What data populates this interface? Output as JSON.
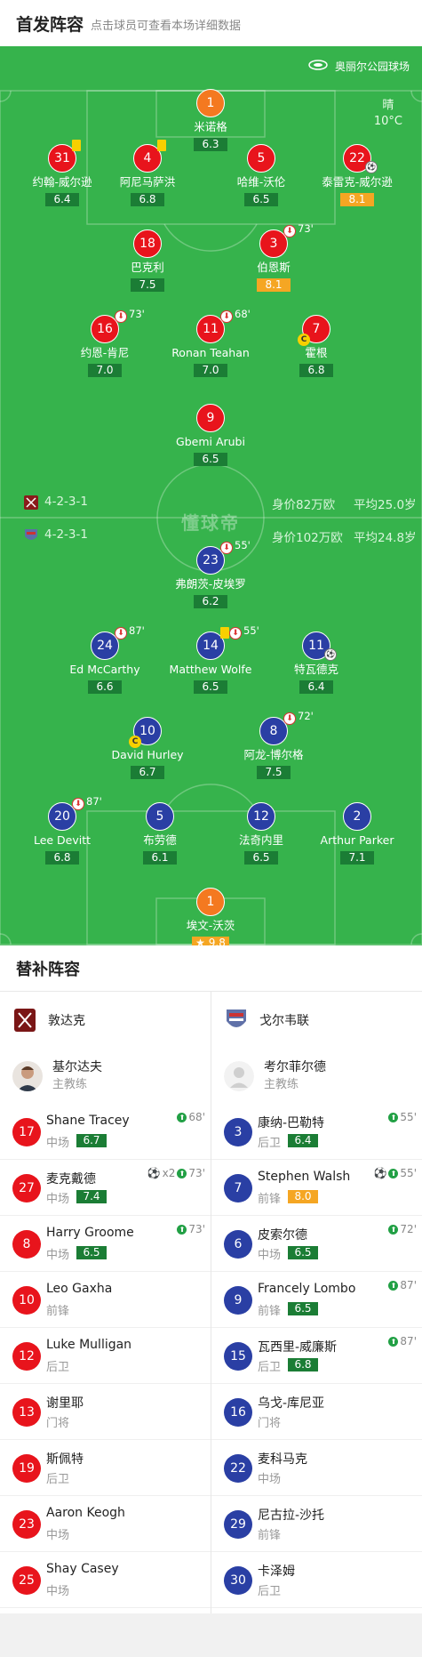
{
  "header": {
    "title": "首发阵容",
    "subtitle": "点击球员可查看本场详细数据"
  },
  "venue": "奥丽尔公园球场",
  "weather": {
    "condition": "晴",
    "temp": "10°C"
  },
  "watermark": "懂球帝",
  "home_team": {
    "formation": "4-2-3-1",
    "value": "身价82万欧",
    "avg_age": "平均25.0岁",
    "color": "#e8141c"
  },
  "away_team": {
    "formation": "4-2-3-1",
    "value": "身价102万欧",
    "avg_age": "平均24.8岁",
    "color": "#2a3fa4"
  },
  "home_players": [
    {
      "num": "1",
      "name": "米诺格",
      "rating": "6.3",
      "gk": true
    },
    {
      "num": "31",
      "name": "约翰-威尔逊",
      "rating": "6.4",
      "yellow": true
    },
    {
      "num": "4",
      "name": "阿尼马萨洪",
      "rating": "6.8",
      "yellow": true
    },
    {
      "num": "5",
      "name": "哈维-沃伦",
      "rating": "6.5"
    },
    {
      "num": "22",
      "name": "泰雷克-威尔逊",
      "rating": "8.1",
      "gold": true,
      "ball": true
    },
    {
      "num": "18",
      "name": "巴克利",
      "rating": "7.5"
    },
    {
      "num": "3",
      "name": "伯恩斯",
      "rating": "8.1",
      "gold": true,
      "sub": "73'"
    },
    {
      "num": "16",
      "name": "约恩-肯尼",
      "rating": "7.0",
      "sub": "73'"
    },
    {
      "num": "11",
      "name": "Ronan Teahan",
      "rating": "7.0",
      "sub": "68'"
    },
    {
      "num": "7",
      "name": "霍根",
      "rating": "6.8",
      "captain": true
    },
    {
      "num": "9",
      "name": "Gbemi Arubi",
      "rating": "6.5"
    }
  ],
  "away_players": [
    {
      "num": "23",
      "name": "弗朗茨-皮埃罗",
      "rating": "6.2",
      "sub": "55'"
    },
    {
      "num": "24",
      "name": "Ed McCarthy",
      "rating": "6.6",
      "sub": "87'"
    },
    {
      "num": "14",
      "name": "Matthew Wolfe",
      "rating": "6.5",
      "yellow": true,
      "sub": "55'"
    },
    {
      "num": "11",
      "name": "特瓦德克",
      "rating": "6.4",
      "ball": true
    },
    {
      "num": "10",
      "name": "David Hurley",
      "rating": "6.7",
      "captain": true
    },
    {
      "num": "8",
      "name": "阿龙-博尔格",
      "rating": "7.5",
      "sub": "72'"
    },
    {
      "num": "20",
      "name": "Lee Devitt",
      "rating": "6.8",
      "sub": "87'"
    },
    {
      "num": "5",
      "name": "布劳德",
      "rating": "6.1"
    },
    {
      "num": "12",
      "name": "法奇内里",
      "rating": "6.5"
    },
    {
      "num": "2",
      "name": "Arthur Parker",
      "rating": "7.1"
    },
    {
      "num": "1",
      "name": "埃文-沃茨",
      "rating": "9.8",
      "gold": true,
      "star": true,
      "gk": true
    }
  ],
  "subs_title": "替补阵容",
  "home_subs": {
    "team": "敦达克",
    "coach": {
      "name": "基尔达夫",
      "role": "主教练"
    },
    "players": [
      {
        "num": "17",
        "name": "Shane Tracey",
        "pos": "中场",
        "rating": "6.7",
        "event": "68'"
      },
      {
        "num": "27",
        "name": "麦克戴德",
        "pos": "中场",
        "rating": "7.4",
        "goals": "x2",
        "event": "73'"
      },
      {
        "num": "8",
        "name": "Harry Groome",
        "pos": "中场",
        "rating": "6.5",
        "event": "73'"
      },
      {
        "num": "10",
        "name": "Leo Gaxha",
        "pos": "前锋"
      },
      {
        "num": "12",
        "name": "Luke Mulligan",
        "pos": "后卫"
      },
      {
        "num": "13",
        "name": "谢里耶",
        "pos": "门将"
      },
      {
        "num": "19",
        "name": "斯佩特",
        "pos": "后卫"
      },
      {
        "num": "23",
        "name": "Aaron Keogh",
        "pos": "中场"
      },
      {
        "num": "25",
        "name": "Shay Casey",
        "pos": "中场"
      }
    ]
  },
  "away_subs": {
    "team": "戈尔韦联",
    "coach": {
      "name": "考尔菲尔德",
      "role": "主教练"
    },
    "players": [
      {
        "num": "3",
        "name": "康纳-巴勒特",
        "pos": "后卫",
        "rating": "6.4",
        "event": "55'"
      },
      {
        "num": "7",
        "name": "Stephen Walsh",
        "pos": "前锋",
        "rating": "8.0",
        "gold": true,
        "goal": true,
        "event": "55'"
      },
      {
        "num": "6",
        "name": "皮索尔德",
        "pos": "中场",
        "rating": "6.5",
        "event": "72'"
      },
      {
        "num": "9",
        "name": "Francely Lombo",
        "pos": "前锋",
        "rating": "6.5",
        "event": "87'"
      },
      {
        "num": "15",
        "name": "瓦西里-威廉斯",
        "pos": "后卫",
        "rating": "6.8",
        "event": "87'"
      },
      {
        "num": "16",
        "name": "乌戈-库尼亚",
        "pos": "门将"
      },
      {
        "num": "22",
        "name": "麦科马克",
        "pos": "中场"
      },
      {
        "num": "29",
        "name": "尼古拉-沙托",
        "pos": "前锋"
      },
      {
        "num": "30",
        "name": "卡泽姆",
        "pos": "后卫"
      }
    ]
  }
}
